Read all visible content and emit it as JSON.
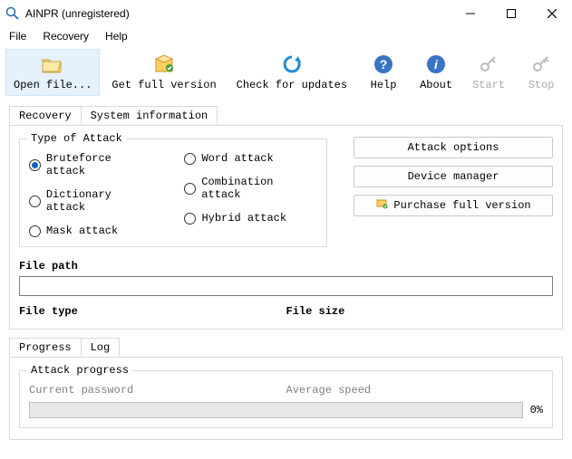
{
  "window": {
    "title": "AINPR (unregistered)"
  },
  "menu": {
    "file": "File",
    "recovery": "Recovery",
    "help": "Help"
  },
  "toolbar": {
    "open": "Open file...",
    "full": "Get full version",
    "check": "Check for updates",
    "help": "Help",
    "about": "About",
    "start": "Start",
    "stop": "Stop"
  },
  "tabs": {
    "recovery": "Recovery",
    "sysinfo": "System information"
  },
  "attack": {
    "legend": "Type of Attack",
    "brute": "Bruteforce attack",
    "dict": "Dictionary attack",
    "mask": "Mask attack",
    "word": "Word attack",
    "combo": "Combination attack",
    "hybrid": "Hybrid attack"
  },
  "sidebuttons": {
    "options": "Attack options",
    "device": "Device manager",
    "purchase": "Purchase full version"
  },
  "filepath": {
    "label": "File path"
  },
  "filemeta": {
    "type": "File type",
    "size": "File size"
  },
  "bottomTabs": {
    "progress": "Progress",
    "log": "Log"
  },
  "progress": {
    "legend": "Attack progress",
    "current": "Current password",
    "speed": "Average speed",
    "percent": "0%"
  }
}
